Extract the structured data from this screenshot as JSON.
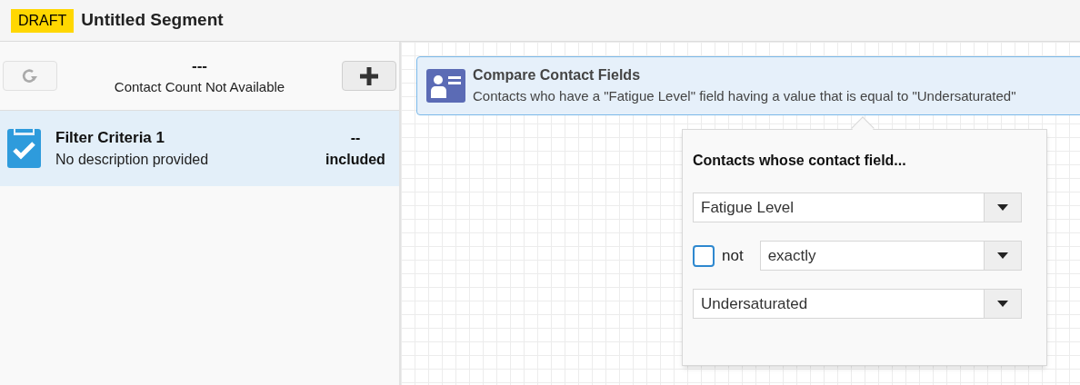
{
  "header": {
    "badge": "DRAFT",
    "title": "Untitled Segment"
  },
  "sidebar": {
    "refresh_button": {
      "disabled": true
    },
    "count": "---",
    "count_label": "Contact Count Not Available",
    "criteria": [
      {
        "title": "Filter Criteria 1",
        "description": "No description provided",
        "count": "--",
        "status": "included",
        "selected": true
      }
    ]
  },
  "canvas": {
    "card": {
      "title": "Compare Contact Fields",
      "description": "Contacts who have a \"Fatigue Level\" field having a value that is equal to \"Undersaturated\""
    },
    "popover": {
      "heading": "Contacts whose contact field...",
      "field": "Fatigue Level",
      "negate": {
        "label": "not",
        "checked": false
      },
      "operator": "exactly",
      "value": "Undersaturated"
    }
  }
}
